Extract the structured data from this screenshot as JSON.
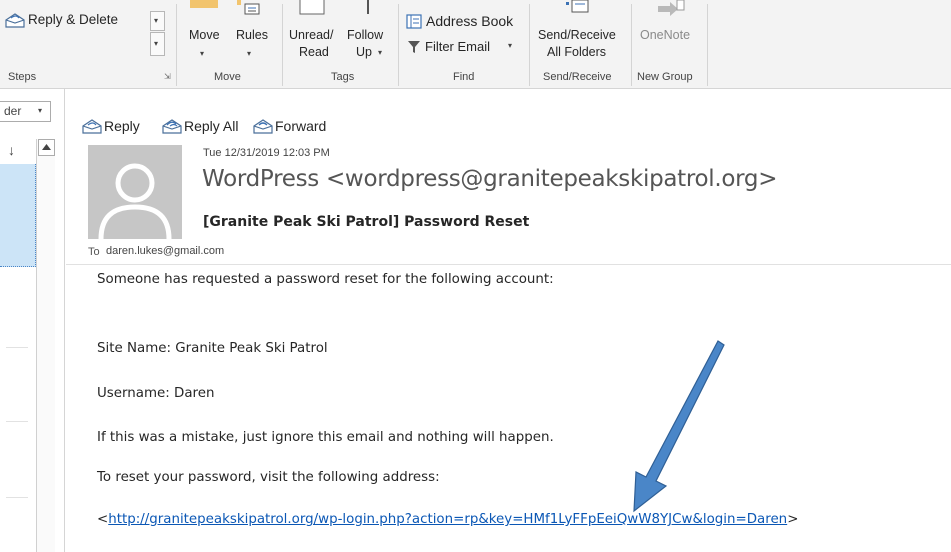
{
  "ribbon": {
    "reply_delete_label": "Reply & Delete",
    "quicksteps_group": "Steps",
    "move_label": "Move",
    "rules_label": "Rules",
    "move_group": "Move",
    "unread_read_line1": "Unread/",
    "unread_read_line2": "Read",
    "follow_up_line1": "Follow",
    "follow_up_line2": "Up",
    "tags_group": "Tags",
    "address_book_label": "Address Book",
    "filter_email_label": "Filter Email",
    "find_group": "Find",
    "send_receive_line1": "Send/Receive",
    "send_receive_line2": "All Folders",
    "send_receive_group": "Send/Receive",
    "onenote_label": "OneNote",
    "new_group": "New Group"
  },
  "left_pane": {
    "folder_dropdown": "der"
  },
  "message": {
    "actions": {
      "reply": "Reply",
      "reply_all": "Reply All",
      "forward": "Forward"
    },
    "date": "Tue 12/31/2019 12:03 PM",
    "sender": "WordPress <wordpress@granitepeakskipatrol.org>",
    "subject": "[Granite Peak Ski Patrol] Password Reset",
    "to_label": "To",
    "to_address": "daren.lukes@gmail.com",
    "body": {
      "line1": "Someone has requested a password reset for the following account:",
      "line2": "Site Name: Granite Peak Ski Patrol",
      "line3": "Username: Daren",
      "line4": "If this was a mistake, just ignore this email and nothing will happen.",
      "line5": "To reset your password, visit the following address:",
      "link_open": "<",
      "link": "http://granitepeakskipatrol.org/wp-login.php?action=rp&key=HMf1LyFFpEeiQwW8YJCw&login=Daren",
      "link_close": ">"
    }
  },
  "colors": {
    "ribbon_bg": "#f3f3f3",
    "link": "#0b57b5",
    "annotation_arrow": "#4a86c8",
    "selected_item": "#cce4f7"
  }
}
